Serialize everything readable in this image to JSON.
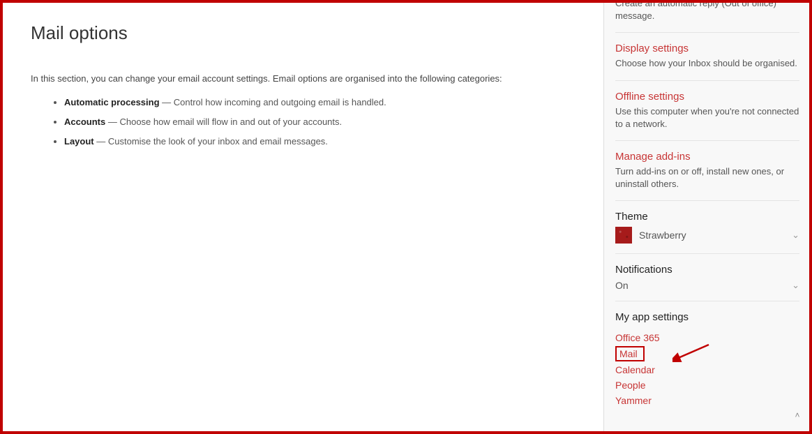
{
  "main": {
    "heading": "Mail options",
    "intro": "In this section, you can change your email account settings. Email options are organised into the following categories:",
    "bullets": [
      {
        "label": "Automatic processing",
        "sep": " — ",
        "text": "Control how incoming and outgoing email is handled."
      },
      {
        "label": "Accounts",
        "sep": " — ",
        "text": "Choose how email will flow in and out of your accounts."
      },
      {
        "label": "Layout",
        "sep": " — ",
        "text": "Customise the look of your inbox and email messages."
      }
    ]
  },
  "sidebar": {
    "truncated_top": {
      "desc": "Create an automatic reply (Out of office) message."
    },
    "display": {
      "title": "Display settings",
      "desc": "Choose how your Inbox should be organised."
    },
    "offline": {
      "title": "Offline settings",
      "desc": "Use this computer when you're not connected to a network."
    },
    "addins": {
      "title": "Manage add-ins",
      "desc": "Turn add-ins on or off, install new ones, or uninstall others."
    },
    "theme": {
      "label": "Theme",
      "value": "Strawberry"
    },
    "notifications": {
      "label": "Notifications",
      "value": "On"
    },
    "appsettings": {
      "label": "My app settings",
      "items": [
        {
          "label": "Office 365",
          "highlighted": false
        },
        {
          "label": "Mail",
          "highlighted": true
        },
        {
          "label": "Calendar",
          "highlighted": false
        },
        {
          "label": "People",
          "highlighted": false
        },
        {
          "label": "Yammer",
          "highlighted": false
        }
      ]
    }
  },
  "annotation": {
    "arrow_color": "#c00000"
  }
}
